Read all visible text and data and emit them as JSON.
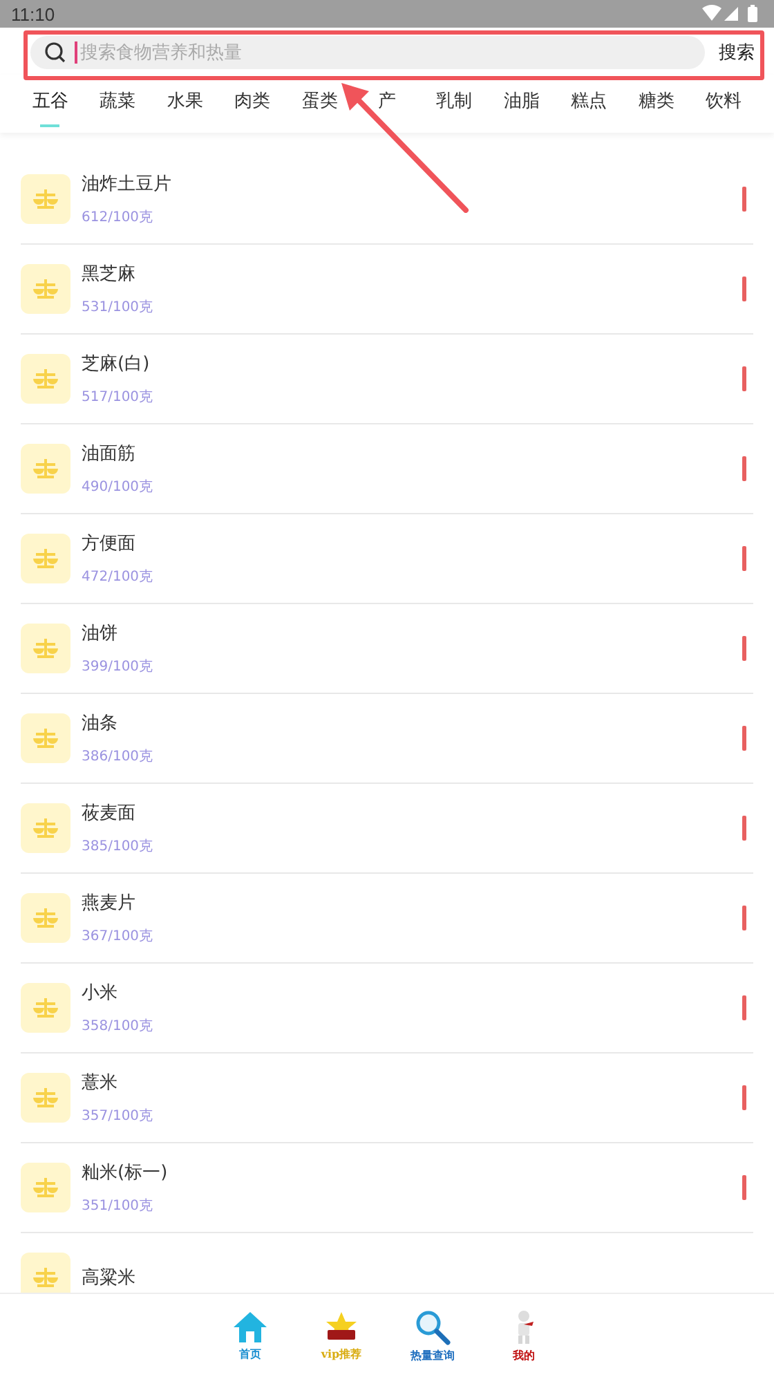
{
  "status_bar": {
    "time": "11:10"
  },
  "search": {
    "placeholder": "搜索食物营养和热量",
    "button": "搜索"
  },
  "tabs": [
    {
      "label": "五谷",
      "selected": true
    },
    {
      "label": "蔬菜",
      "selected": false
    },
    {
      "label": "水果",
      "selected": false
    },
    {
      "label": "肉类",
      "selected": false
    },
    {
      "label": "蛋类",
      "selected": false
    },
    {
      "label": "产",
      "selected": false
    },
    {
      "label": "乳制",
      "selected": false
    },
    {
      "label": "油脂",
      "selected": false
    },
    {
      "label": "糕点",
      "selected": false
    },
    {
      "label": "糖类",
      "selected": false
    },
    {
      "label": "饮料",
      "selected": false
    }
  ],
  "foods": [
    {
      "name": "油炸土豆片",
      "calories": "612/100克"
    },
    {
      "name": "黑芝麻",
      "calories": "531/100克"
    },
    {
      "name": "芝麻(白)",
      "calories": "517/100克"
    },
    {
      "name": "油面筋",
      "calories": "490/100克"
    },
    {
      "name": "方便面",
      "calories": "472/100克"
    },
    {
      "name": "油饼",
      "calories": "399/100克"
    },
    {
      "name": "油条",
      "calories": "386/100克"
    },
    {
      "name": "莜麦面",
      "calories": "385/100克"
    },
    {
      "name": "燕麦片",
      "calories": "367/100克"
    },
    {
      "name": "小米",
      "calories": "358/100克"
    },
    {
      "name": "薏米",
      "calories": "357/100克"
    },
    {
      "name": "籼米(标一)",
      "calories": "351/100克"
    },
    {
      "name": "高粱米"
    }
  ],
  "bottom_nav": [
    {
      "label": "首页",
      "kind": "home",
      "color": "#1b8fd0"
    },
    {
      "label": "vip推荐",
      "kind": "vip",
      "color": "#d9ac10"
    },
    {
      "label": "热量查询",
      "kind": "search",
      "color": "#1f6fbf"
    },
    {
      "label": "我的",
      "kind": "me",
      "color": "#c01010"
    }
  ]
}
